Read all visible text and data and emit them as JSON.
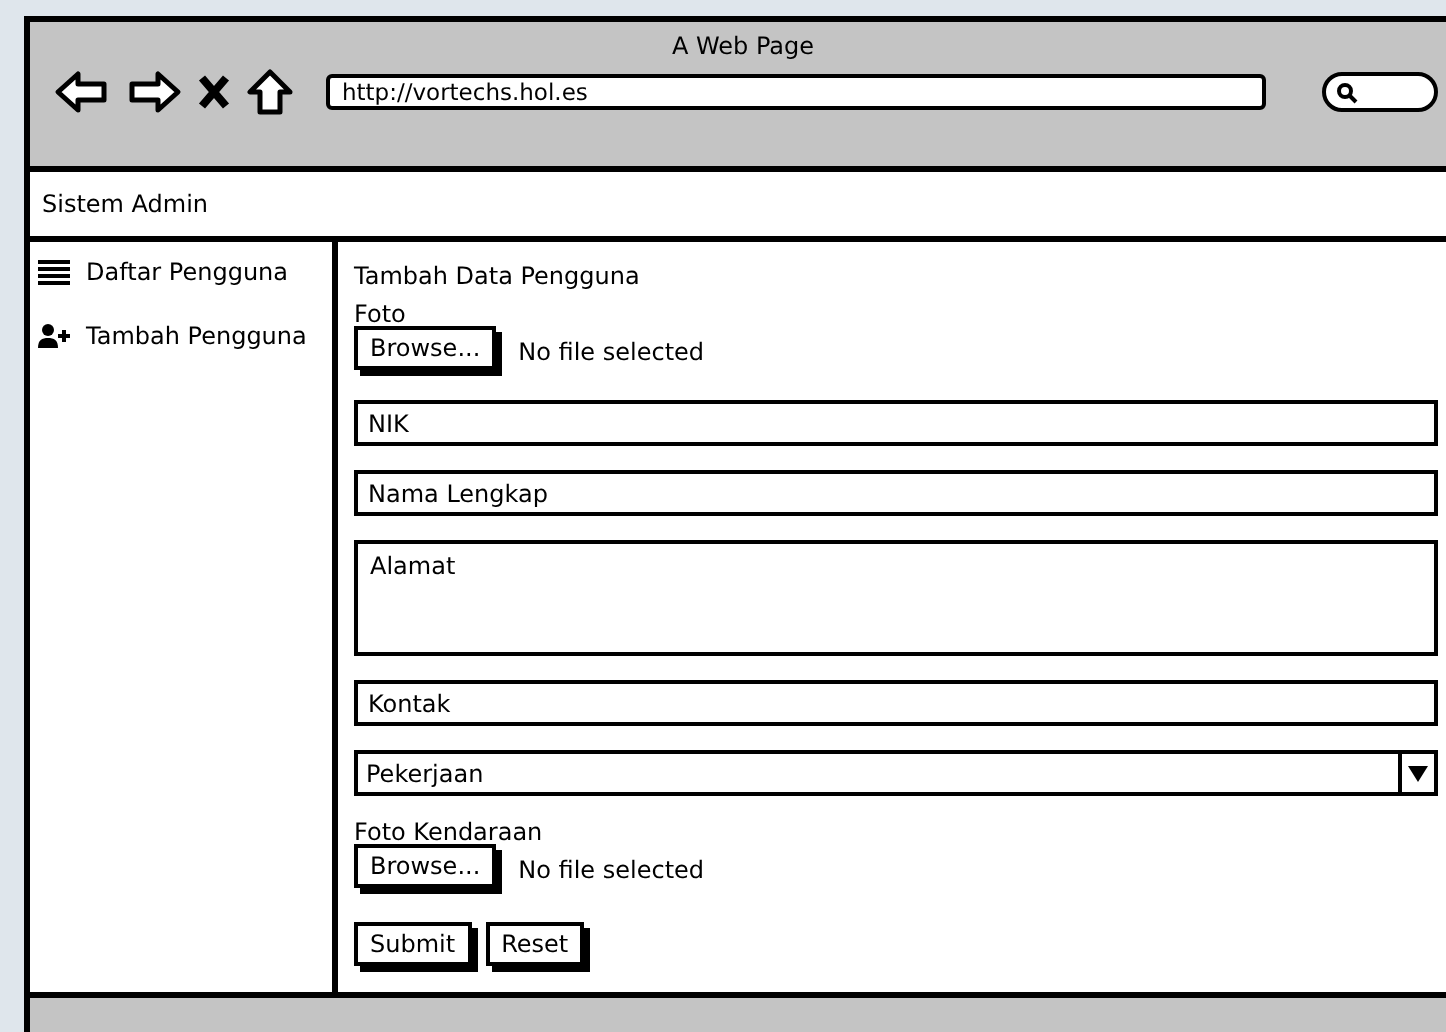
{
  "window": {
    "title": "A Web Page"
  },
  "address_bar": {
    "value": "http://vortechs.hol.es"
  },
  "header": {
    "title": "Sistem Admin"
  },
  "sidebar": {
    "items": [
      {
        "label": "Daftar Pengguna",
        "kind": "list"
      },
      {
        "label": "Tambah Pengguna",
        "kind": "add-user"
      }
    ]
  },
  "form": {
    "title": "Tambah Data Pengguna",
    "fields": [
      {
        "kind": "file",
        "label": "Foto",
        "button": "Browse...",
        "status": "No file selected"
      },
      {
        "kind": "text",
        "placeholder": "NIK"
      },
      {
        "kind": "text",
        "placeholder": "Nama Lengkap"
      },
      {
        "kind": "textarea",
        "placeholder": "Alamat"
      },
      {
        "kind": "text",
        "placeholder": "Kontak"
      },
      {
        "kind": "select",
        "value": "Pekerjaan"
      },
      {
        "kind": "file",
        "label": "Foto Kendaraan",
        "button": "Browse...",
        "status": "No file selected"
      }
    ],
    "buttons": [
      "Submit",
      "Reset"
    ]
  }
}
